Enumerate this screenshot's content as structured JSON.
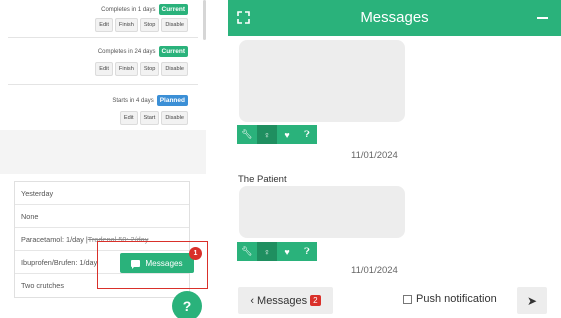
{
  "left_panel": {
    "cards": [
      {
        "status_text": "Completes in 1 days",
        "badge": "Current",
        "badge_color": "#2ab27b",
        "buttons": [
          "Edit",
          "Finish",
          "Stop",
          "Disable"
        ]
      },
      {
        "status_text": "Completes in 24 days",
        "badge": "Current",
        "badge_color": "#2ab27b",
        "buttons": [
          "Edit",
          "Finish",
          "Stop",
          "Disable"
        ]
      },
      {
        "status_text": "Starts in 4 days",
        "badge": "Planned",
        "badge_color": "#3b8fd6",
        "buttons": [
          "Edit",
          "Start",
          "Disable"
        ]
      }
    ],
    "table_rows": [
      "Yesterday",
      "None",
      "Ibuprofen/Brufen: 1/day",
      "Two crutches"
    ],
    "paracetamol_row": {
      "prefix": "Paracetamol: 1/day | ",
      "struck": "Tradenal 50: 2/day"
    },
    "messages_button": {
      "label": "Messages",
      "badge_count": "1"
    },
    "help_button": {
      "label": "?"
    }
  },
  "chat": {
    "title": "Messages",
    "header_color": "#2ab27b",
    "messages": [
      {
        "date": "11/01/2024",
        "sender": ""
      },
      {
        "date": "11/01/2024",
        "sender": "The Patient"
      }
    ],
    "message_icons": [
      "wrench-icon",
      "person-icon",
      "heart-icon",
      "question-icon"
    ],
    "back_button": {
      "label": "Messages",
      "count": "2"
    },
    "push_notification_label": "Push notification",
    "send_icon": "send-icon"
  }
}
